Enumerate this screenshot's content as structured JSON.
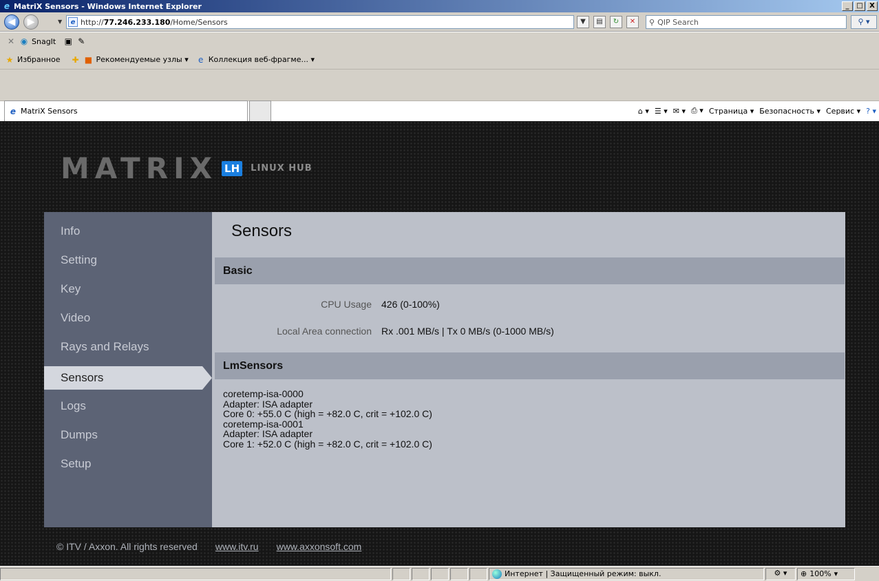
{
  "window": {
    "title": "MatriX Sensors - Windows Internet Explorer",
    "controls": [
      "_",
      "□",
      "X"
    ]
  },
  "addressbar": {
    "url_prefix": "http://",
    "url_host": "77.246.233.180",
    "url_path": "/Home/Sensors",
    "search_placeholder": "QIP Search"
  },
  "toolbar": {
    "snagit_label": "SnagIt"
  },
  "favorites": {
    "favorites_label": "Избранное",
    "recommended_label": "Рекомендуемые узлы ▾",
    "gallery_label": "Коллекция веб-фрагме... ▾"
  },
  "tab": {
    "label": "MatriX Sensors"
  },
  "commandbar": {
    "page_label": "Страница ▾",
    "safety_label": "Безопасность ▾",
    "tools_label": "Сервис ▾"
  },
  "brand": {
    "name": "MATRIX",
    "badge": "LH",
    "subtitle": "LINUX HUB"
  },
  "sidebar": {
    "items": [
      {
        "label": "Info"
      },
      {
        "label": "Setting"
      },
      {
        "label": "Key"
      },
      {
        "label": "Video"
      },
      {
        "label": "Rays and Relays"
      },
      {
        "label": "Sensors"
      },
      {
        "label": "Logs"
      },
      {
        "label": "Dumps"
      },
      {
        "label": "Setup"
      }
    ],
    "active": "Sensors"
  },
  "main": {
    "title": "Sensors",
    "basic": {
      "heading": "Basic",
      "cpu_label": "CPU Usage",
      "cpu_value": "426 (0-100%)",
      "lan_label": "Local Area connection",
      "lan_value": "Rx .001 MB/s | Tx 0 MB/s (0-1000 MB/s)"
    },
    "lmsensors": {
      "heading": "LmSensors",
      "lines": [
        "coretemp-isa-0000",
        "Adapter: ISA adapter",
        "Core 0: +55.0 C (high = +82.0 C, crit = +102.0 C)",
        "coretemp-isa-0001",
        "Adapter: ISA adapter",
        "Core 1: +52.0 C (high = +82.0 C, crit = +102.0 C)"
      ]
    }
  },
  "footer": {
    "copyright": "© ITV / Axxon. All rights reserved",
    "link1": "www.itv.ru",
    "link2": "www.axxonsoft.com"
  },
  "statusbar": {
    "zone_text": "Интернет | Защищенный режим: выкл.",
    "zoom": "100%"
  }
}
